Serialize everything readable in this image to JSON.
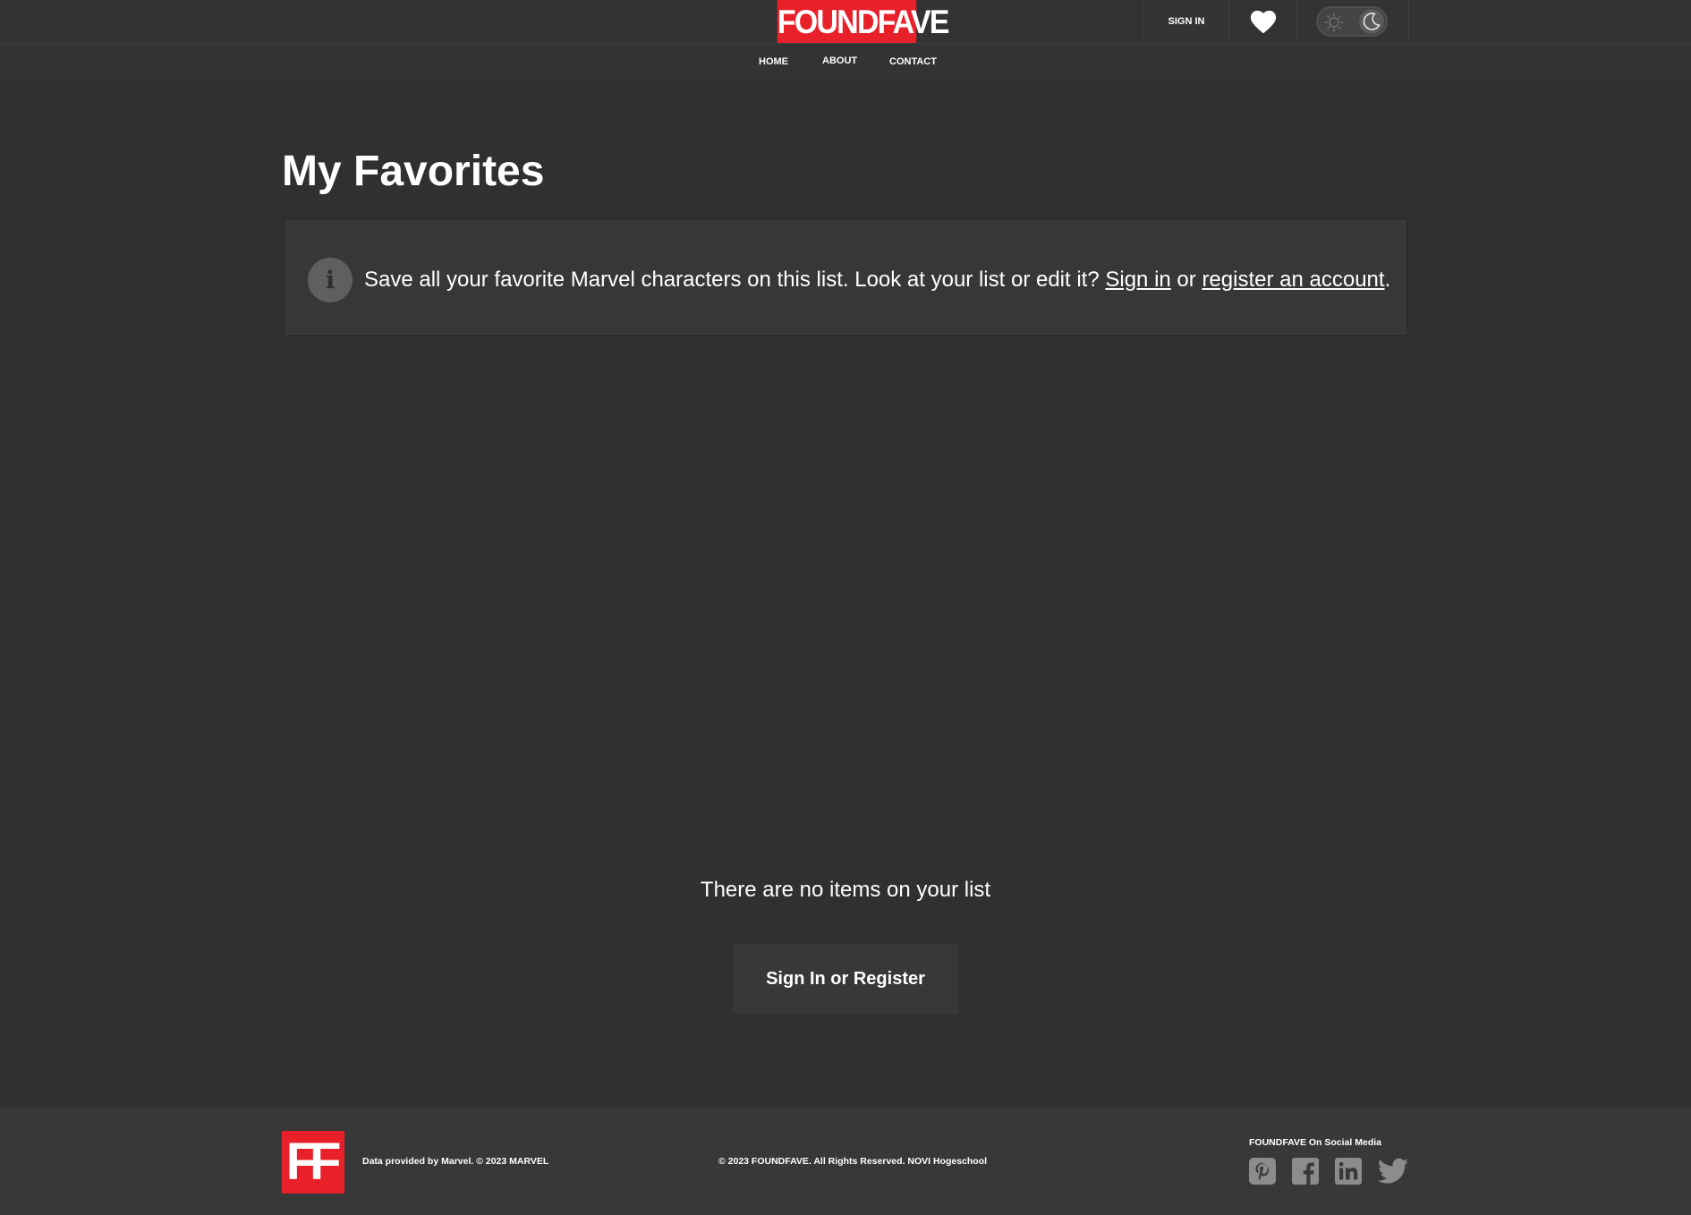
{
  "header": {
    "logo_text": "FOUNDFAVE",
    "signin_label": "SIGN IN",
    "heart_icon": "heart-icon",
    "theme_toggle": {
      "state": "dark",
      "icons": [
        "sun-icon",
        "moon-icon"
      ]
    }
  },
  "nav": {
    "items": [
      {
        "label": "HOME"
      },
      {
        "label": "ABOUT"
      },
      {
        "label": "CONTACT"
      }
    ]
  },
  "main": {
    "title": "My Favorites",
    "info": {
      "icon": "info-icon",
      "text_before": "Save all your favorite Marvel characters on this list. Look at your list or edit it? ",
      "signin_link": "Sign in",
      "text_middle": " or ",
      "register_link": "register an account",
      "text_after": "."
    },
    "empty_message": "There are no items on your list",
    "cta_label": "Sign In or Register"
  },
  "footer": {
    "logo_text": "FF",
    "credit": "Data provided by Marvel. © 2023 MARVEL",
    "copyright": "© 2023 FOUNDFAVE. All Rights Reserved. NOVI Hogeschool",
    "social_heading": "FOUNDFAVE On Social Media",
    "social_icons": [
      "pinterest-icon",
      "facebook-icon",
      "linkedin-icon",
      "twitter-icon"
    ]
  },
  "colors": {
    "background": "#303030",
    "header_background": "#333333",
    "brand_red": "#e8202a",
    "info_box": "#373737",
    "button": "#383838",
    "social_icon": "#8c8c8c"
  }
}
